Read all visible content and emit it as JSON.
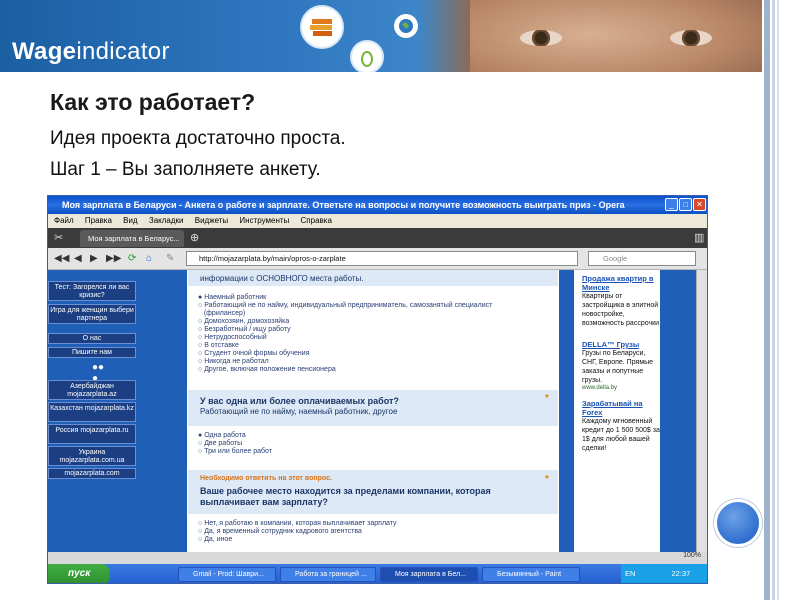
{
  "header": {
    "brand_prefix": "Wage",
    "brand_suffix": "indicator"
  },
  "slide": {
    "title": "Как это работает?",
    "line1": "Идея проекта достаточно проста.",
    "line2": "Шаг 1 – Вы заполняете анкету."
  },
  "browser": {
    "window_title": "Моя зарплата в Беларуси - Анкета о работе и зарплате. Ответьте на вопросы и получите возможность выиграть приз - Opera",
    "menu": [
      "Файл",
      "Правка",
      "Вид",
      "Закладки",
      "Виджеты",
      "Инструменты",
      "Справка"
    ],
    "tab_label": "Моя зарплата в Беларус...",
    "address": "http://mojazarplata.by/main/opros-o-zarplate",
    "search_placeholder": "Google",
    "zoom": "100%"
  },
  "leftnav": {
    "items": [
      "Тест: Загорелся ли вас кризис?",
      "Игра для женщин выбери партнера",
      "О нас",
      "Пишите нам",
      "Азербайджан mojazarplata.az",
      "Казахстан mojazarplata.kz",
      "Россия mojazarplata.ru",
      "Украина mojazarplata.com.ua",
      "mojazarplata.com"
    ]
  },
  "form": {
    "q1_tail": "информации с ОСНОВНОГО места работы.",
    "q1_options": [
      "Наемный работник",
      "Работающий не по найму, индивидуальный предприниматель, самозанятый специалист",
      "(фрилансер)",
      "Домохозяин, домохозяйка",
      "Безработный / ищу работу",
      "Нетрудоспособный",
      "В отставке",
      "Студент очной формы обучения",
      "Никогда не работал",
      "Другое, включая положение пенсионера"
    ],
    "q2": "У вас одна или более оплачиваемых работ?",
    "q2_sub": "Работающий не по найму, наемный работник, другое",
    "q2_options": [
      "Одна работа",
      "Две работы",
      "Три или более работ"
    ],
    "q3_warning": "Необходимо ответить на этот вопрос.",
    "q3": "Ваше рабочее место находится за пределами компании, которая выплачивает вам зарплату?",
    "q3_options": [
      "Нет, я работаю в компании, которая выплачивает зарплату",
      "Да, я временный сотрудник кадрового агентства",
      "Да, иное"
    ],
    "star": "*"
  },
  "ads": [
    {
      "head": "Продажа квартир в Минске",
      "body": "Квартиры от застройщика в элитной новостройке, возможность рассрочки",
      "src": ""
    },
    {
      "head": "DELLA™ Грузы",
      "body": "Грузы по Беларуси, СНГ, Европе. Прямые заказы и попутные грузы.",
      "src": "www.della.by"
    },
    {
      "head": "Зарабатывай на Forex",
      "body": "Каждому мгновенный кредит до 1 500 500$ за 1$ для любой вашей сделки!",
      "src": ""
    }
  ],
  "taskbar": {
    "start": "пуск",
    "tasks": [
      "Gmail - Prod: Шаври...",
      "Работа за границей ...",
      "Моя зарплата в Бел...",
      "Безымянный - Paint"
    ],
    "lang": "EN",
    "clock": "22:37"
  }
}
